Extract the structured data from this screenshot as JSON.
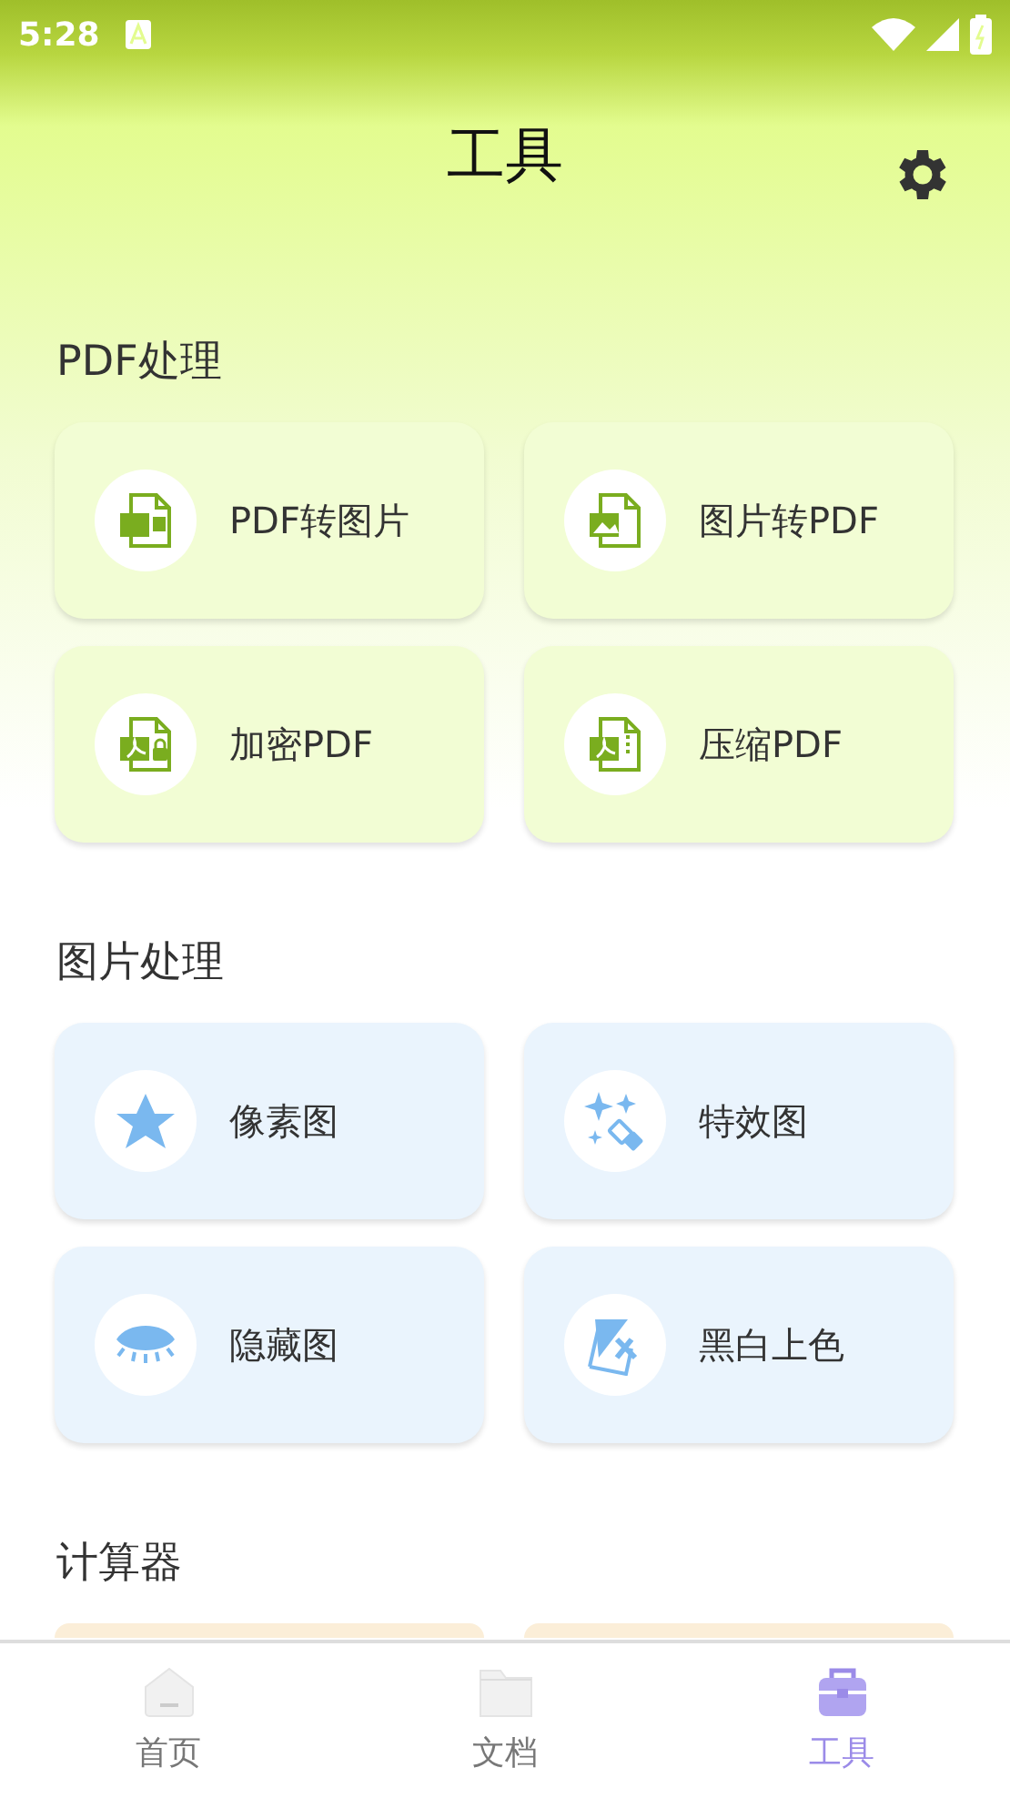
{
  "status_bar": {
    "time": "5:28"
  },
  "header": {
    "title": "工具"
  },
  "sections": [
    {
      "title": "PDF处理",
      "kind": "pdf",
      "items": [
        {
          "label": "PDF转图片"
        },
        {
          "label": "图片转PDF"
        },
        {
          "label": "加密PDF"
        },
        {
          "label": "压缩PDF"
        }
      ]
    },
    {
      "title": "图片处理",
      "kind": "image",
      "items": [
        {
          "label": "像素图"
        },
        {
          "label": "特效图"
        },
        {
          "label": "隐藏图"
        },
        {
          "label": "黑白上色"
        }
      ]
    },
    {
      "title": "计算器",
      "kind": "calc"
    }
  ],
  "tabs": [
    {
      "label": "首页",
      "selected": false
    },
    {
      "label": "文档",
      "selected": false
    },
    {
      "label": "工具",
      "selected": true
    }
  ]
}
